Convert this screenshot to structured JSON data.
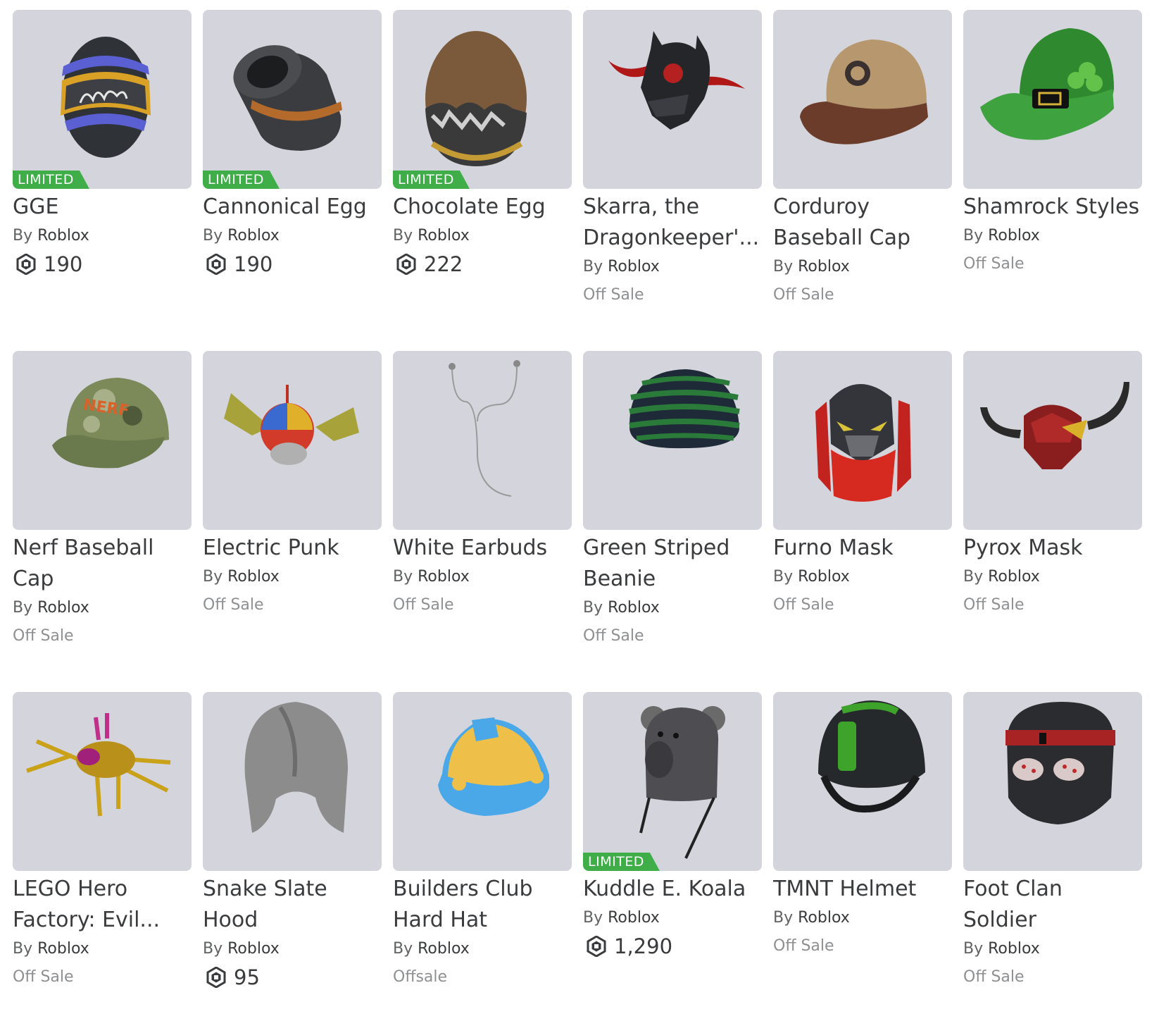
{
  "labels": {
    "limited": "LIMITED",
    "by": "By",
    "robux_icon": "robux-icon"
  },
  "items": [
    {
      "name": "GGE",
      "creator": "Roblox",
      "limited": true,
      "price": "190",
      "offsale": null,
      "icon": "easter-egg-gge-icon"
    },
    {
      "name": "Cannonical Egg",
      "creator": "Roblox",
      "limited": true,
      "price": "190",
      "offsale": null,
      "icon": "cannon-egg-icon"
    },
    {
      "name": "Chocolate Egg",
      "creator": "Roblox",
      "limited": true,
      "price": "222",
      "offsale": null,
      "icon": "chocolate-egg-icon"
    },
    {
      "name": "Skarra, the Dragonkeeper'...",
      "creator": "Roblox",
      "limited": false,
      "price": null,
      "offsale": "Off Sale",
      "icon": "horned-helmet-icon"
    },
    {
      "name": "Corduroy Baseball Cap",
      "creator": "Roblox",
      "limited": false,
      "price": null,
      "offsale": "Off Sale",
      "icon": "baseball-cap-icon"
    },
    {
      "name": "Shamrock Styles",
      "creator": "Roblox",
      "limited": false,
      "price": null,
      "offsale": "Off Sale",
      "icon": "shamrock-cap-icon"
    },
    {
      "name": "Nerf Baseball Cap",
      "creator": "Roblox",
      "limited": false,
      "price": null,
      "offsale": "Off Sale",
      "icon": "camo-cap-icon"
    },
    {
      "name": "Electric Punk",
      "creator": "Roblox",
      "limited": false,
      "price": null,
      "offsale": "Off Sale",
      "icon": "electric-helmet-icon"
    },
    {
      "name": "White Earbuds",
      "creator": "Roblox",
      "limited": false,
      "price": null,
      "offsale": "Off Sale",
      "icon": "earbuds-icon"
    },
    {
      "name": "Green Striped Beanie",
      "creator": "Roblox",
      "limited": false,
      "price": null,
      "offsale": "Off Sale",
      "icon": "beanie-icon"
    },
    {
      "name": "Furno Mask",
      "creator": "Roblox",
      "limited": false,
      "price": null,
      "offsale": "Off Sale",
      "icon": "furno-mask-icon"
    },
    {
      "name": "Pyrox Mask",
      "creator": "Roblox",
      "limited": false,
      "price": null,
      "offsale": "Off Sale",
      "icon": "pyrox-mask-icon"
    },
    {
      "name": "LEGO Hero Factory: Evil...",
      "creator": "Roblox",
      "limited": false,
      "price": null,
      "offsale": "Off Sale",
      "icon": "gold-spider-icon"
    },
    {
      "name": "Snake Slate Hood",
      "creator": "Roblox",
      "limited": false,
      "price": "95",
      "offsale": null,
      "icon": "slate-hood-icon"
    },
    {
      "name": "Builders Club Hard Hat",
      "creator": "Roblox",
      "limited": false,
      "price": null,
      "offsale": "Offsale",
      "icon": "hard-hat-icon"
    },
    {
      "name": "Kuddle E. Koala",
      "creator": "Roblox",
      "limited": true,
      "price": "1,290",
      "offsale": null,
      "icon": "koala-hat-icon"
    },
    {
      "name": "TMNT Helmet",
      "creator": "Roblox",
      "limited": false,
      "price": null,
      "offsale": "Off Sale",
      "icon": "tmnt-helmet-icon"
    },
    {
      "name": "Foot Clan Soldier",
      "creator": "Roblox",
      "limited": false,
      "price": null,
      "offsale": "Off Sale",
      "icon": "foot-clan-mask-icon"
    }
  ]
}
